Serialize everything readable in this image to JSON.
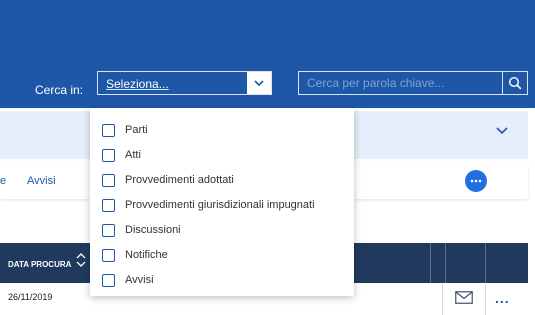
{
  "header": {
    "search_in_label": "Cerca in:",
    "select": {
      "value": "Seleziona..."
    },
    "search": {
      "placeholder": "Cerca per parola chiave..."
    }
  },
  "dropdown": {
    "options": [
      {
        "label": "Parti",
        "checked": false
      },
      {
        "label": "Atti",
        "checked": false
      },
      {
        "label": "Provvedimenti adottati",
        "checked": false
      },
      {
        "label": "Provvedimenti giurisdizionali impugnati",
        "checked": false
      },
      {
        "label": "Discussioni",
        "checked": false
      },
      {
        "label": "Notifiche",
        "checked": false
      },
      {
        "label": "Avvisi",
        "checked": false
      }
    ]
  },
  "tabs": {
    "partial_left": "e",
    "avvisi": "Avvisi"
  },
  "table": {
    "columns": {
      "data_procura": "DATA PROCURA"
    },
    "rows": [
      {
        "data_procura": "26/11/2019",
        "more": "..."
      }
    ]
  },
  "colors": {
    "header_bg": "#1f57a8",
    "table_head_bg": "#203a5f",
    "accent": "#1f6fe0",
    "panel_bg": "#e7eefb"
  },
  "icons": [
    "chevron-down-icon",
    "search-icon",
    "more-icon",
    "sort-icon",
    "mail-icon"
  ]
}
